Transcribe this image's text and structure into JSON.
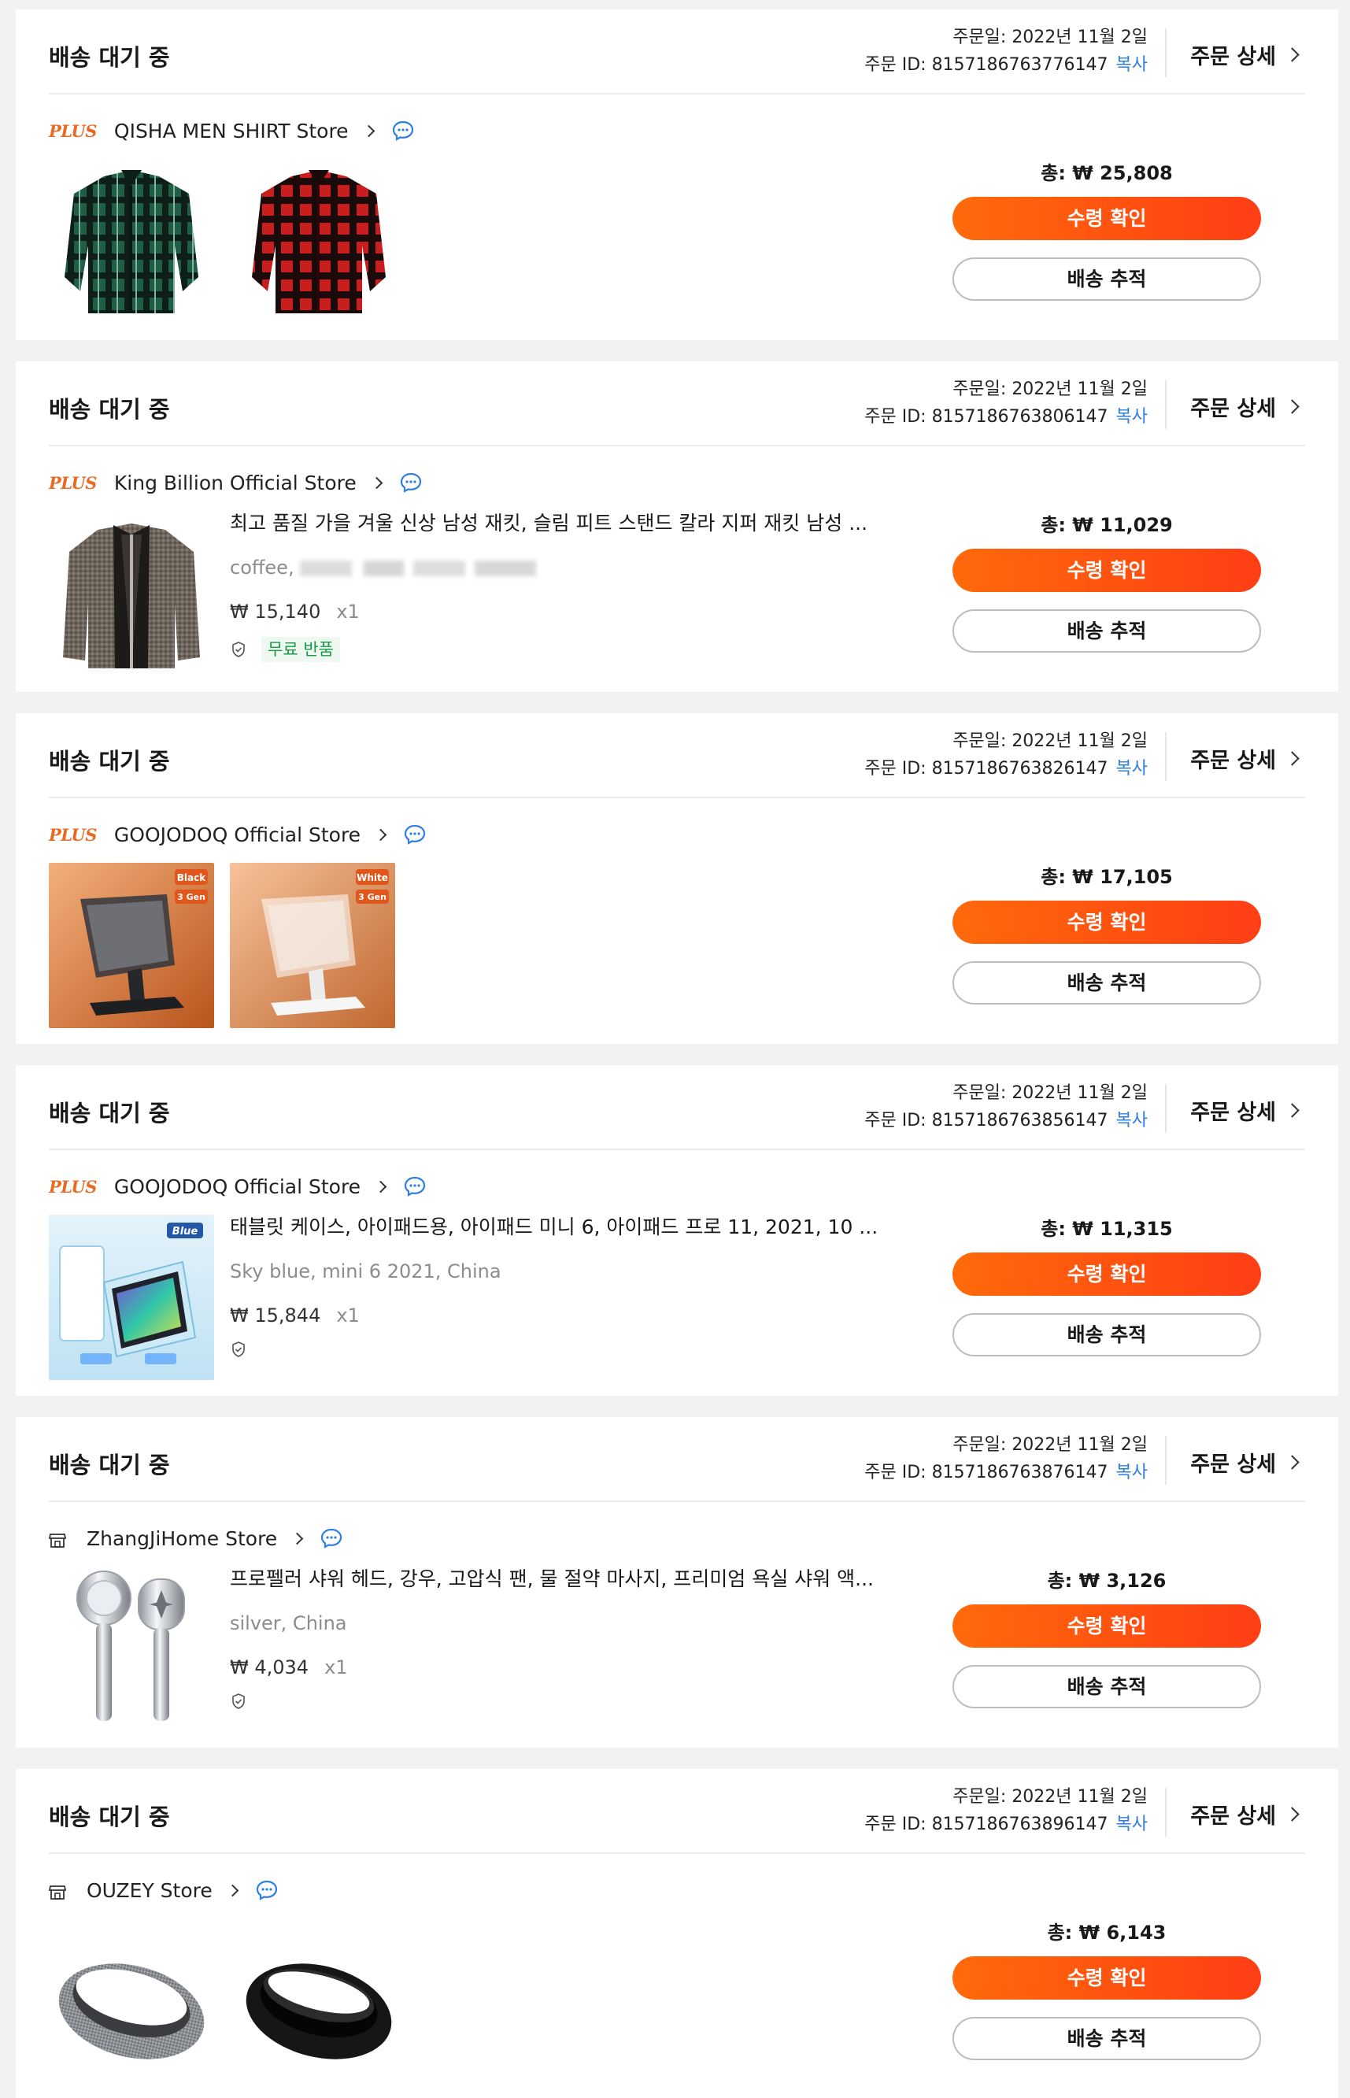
{
  "common": {
    "status": "배송 대기 중",
    "order_date_label": "주문일: 2022년 11월 2일",
    "order_id_prefix": "주문 ID: ",
    "copy_label": "복사",
    "detail_label": "주문 상세",
    "total_prefix": "총: ",
    "confirm_label": "수령 확인",
    "track_label": "배송 추적",
    "plus_badge": "PLUS",
    "free_return": "무료 반품"
  },
  "orders": [
    {
      "order_id": "8157186763776147",
      "store": "QISHA MEN SHIRT Store",
      "store_badge": "plus",
      "total": "₩ 25,808",
      "products": [
        {
          "thumb_icon": "green-plaid-shirt-image"
        },
        {
          "thumb_icon": "red-plaid-shirt-image"
        }
      ]
    },
    {
      "order_id": "8157186763806147",
      "store": "King Billion Official Store",
      "store_badge": "plus",
      "total": "₩ 11,029",
      "product_title": "최고 품질 가을 겨울 신상 남성 재킷, 슬림 피트 스탠드 칼라 지퍼 재킷 남성 ...",
      "product_variant": "coffee,",
      "product_price": "₩ 15,140",
      "product_qty": "x1",
      "thumb_icon": "knit-jacket-image"
    },
    {
      "order_id": "8157186763826147",
      "store": "GOOJODOQ Official Store",
      "store_badge": "plus",
      "total": "₩ 17,105",
      "products": [
        {
          "thumb_icon": "black-tablet-stand-image",
          "tag1": "Black",
          "tag2": "3 Gen"
        },
        {
          "thumb_icon": "white-tablet-stand-image",
          "tag1": "White",
          "tag2": "3 Gen"
        }
      ]
    },
    {
      "order_id": "8157186763856147",
      "store": "GOOJODOQ Official Store",
      "store_badge": "plus",
      "total": "₩ 11,315",
      "product_title": "태블릿 케이스, 아이패드용, 아이패드 미니 6, 아이패드 프로 11, 2021, 10 ...",
      "product_variant": "Sky blue, mini 6 2021, China",
      "product_price": "₩ 15,844",
      "product_qty": "x1",
      "thumb_icon": "tablet-case-image",
      "thumb_tag": "Blue"
    },
    {
      "order_id": "8157186763876147",
      "store": "ZhangJiHome Store",
      "store_badge": "shop",
      "total": "₩ 3,126",
      "product_title": "프로펠러 샤워 헤드, 강우, 고압식 팬, 물 절약 마사지, 프리미엄 욕실 샤워 액...",
      "product_variant": "silver, China",
      "product_price": "₩ 4,034",
      "product_qty": "x1",
      "thumb_icon": "shower-head-image"
    },
    {
      "order_id": "8157186763896147",
      "store": "OUZEY Store",
      "store_badge": "shop",
      "total": "₩ 6,143",
      "products": [
        {
          "thumb_icon": "grey-headband-image"
        },
        {
          "thumb_icon": "black-headband-image"
        }
      ]
    }
  ],
  "colors": {
    "accent": "#ff4f12",
    "link": "#2e7de1",
    "plus_badge": "#e86a24",
    "free_return": "#1a9a46"
  }
}
